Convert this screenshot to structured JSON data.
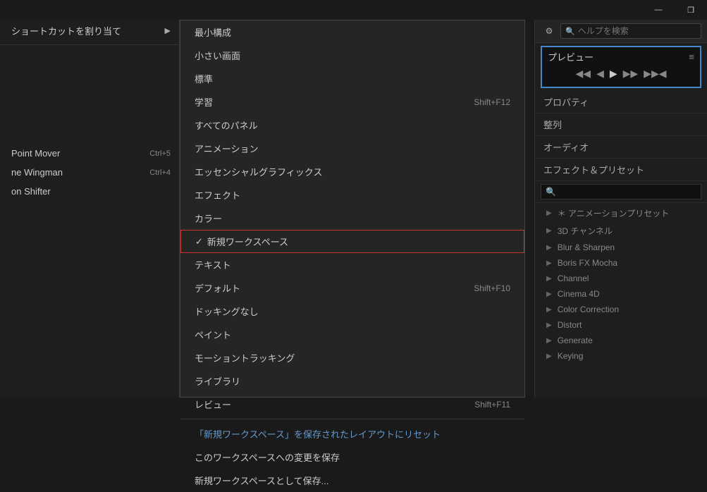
{
  "titlebar": {
    "minimize_label": "—",
    "maximize_label": "❐"
  },
  "left_panel": {
    "items": [
      {
        "label": "ショートカットを割り当て",
        "has_arrow": true,
        "shortcut": ""
      },
      {
        "label": "",
        "is_divider": true
      },
      {
        "label": "Point Mover",
        "has_arrow": false,
        "shortcut": "Ctrl+5"
      },
      {
        "label": "ne Wingman",
        "has_arrow": false,
        "shortcut": "Ctrl+4"
      },
      {
        "label": "on Shifter",
        "has_arrow": false,
        "shortcut": ""
      }
    ]
  },
  "dropdown": {
    "items": [
      {
        "label": "最小構成",
        "shortcut": "",
        "type": "normal"
      },
      {
        "label": "小さい画面",
        "shortcut": "",
        "type": "normal"
      },
      {
        "label": "標準",
        "shortcut": "",
        "type": "normal"
      },
      {
        "label": "学習",
        "shortcut": "Shift+F12",
        "type": "normal"
      },
      {
        "label": "すべてのパネル",
        "shortcut": "",
        "type": "normal"
      },
      {
        "label": "アニメーション",
        "shortcut": "",
        "type": "normal"
      },
      {
        "label": "エッセンシャルグラフィックス",
        "shortcut": "",
        "type": "normal"
      },
      {
        "label": "エフェクト",
        "shortcut": "",
        "type": "normal"
      },
      {
        "label": "カラー",
        "shortcut": "",
        "type": "normal"
      },
      {
        "label": "新規ワークスペース",
        "shortcut": "",
        "type": "highlighted",
        "check": "✓"
      },
      {
        "label": "テキスト",
        "shortcut": "",
        "type": "normal"
      },
      {
        "label": "デフォルト",
        "shortcut": "Shift+F10",
        "type": "normal"
      },
      {
        "label": "ドッキングなし",
        "shortcut": "",
        "type": "normal"
      },
      {
        "label": "ペイント",
        "shortcut": "",
        "type": "normal"
      },
      {
        "label": "モーショントラッキング",
        "shortcut": "",
        "type": "normal"
      },
      {
        "label": "ライブラリ",
        "shortcut": "",
        "type": "normal"
      },
      {
        "label": "レビュー",
        "shortcut": "Shift+F11",
        "type": "normal"
      },
      {
        "label": "divider",
        "type": "divider"
      },
      {
        "label": "「新規ワークスペース」を保存されたレイアウトにリセット",
        "shortcut": "",
        "type": "link"
      },
      {
        "label": "このワークスペースへの変更を保存",
        "shortcut": "",
        "type": "normal"
      },
      {
        "label": "新規ワークスペースとして保存...",
        "shortcut": "",
        "type": "normal"
      }
    ]
  },
  "right_panel": {
    "toolbar": {
      "gear_icon": "⚙",
      "search_placeholder": "ヘルプを検索"
    },
    "preview": {
      "title": "プレビュー",
      "menu_icon": "≡",
      "controls": [
        "◀◀",
        "◀",
        "▶",
        "▶▶",
        "▶▶◀"
      ]
    },
    "sections": [
      {
        "label": "プロパティ"
      },
      {
        "label": "整列"
      },
      {
        "label": "オーディオ"
      },
      {
        "label": "エフェクト＆プリセット"
      }
    ],
    "effects_search_placeholder": "🔍",
    "effects_list": [
      {
        "label": "＊ アニメーションプリセット",
        "arrow": ">"
      },
      {
        "label": "3D チャンネル",
        "arrow": ">"
      },
      {
        "label": "Blur & Sharpen",
        "arrow": ">"
      },
      {
        "label": "Boris FX Mocha",
        "arrow": ">"
      },
      {
        "label": "Channel",
        "arrow": ">"
      },
      {
        "label": "Cinema 4D",
        "arrow": ">"
      },
      {
        "label": "Color Correction",
        "arrow": ">"
      },
      {
        "label": "Distort",
        "arrow": ">"
      },
      {
        "label": "Generate",
        "arrow": ">"
      },
      {
        "label": "Keying",
        "arrow": ">"
      }
    ]
  }
}
